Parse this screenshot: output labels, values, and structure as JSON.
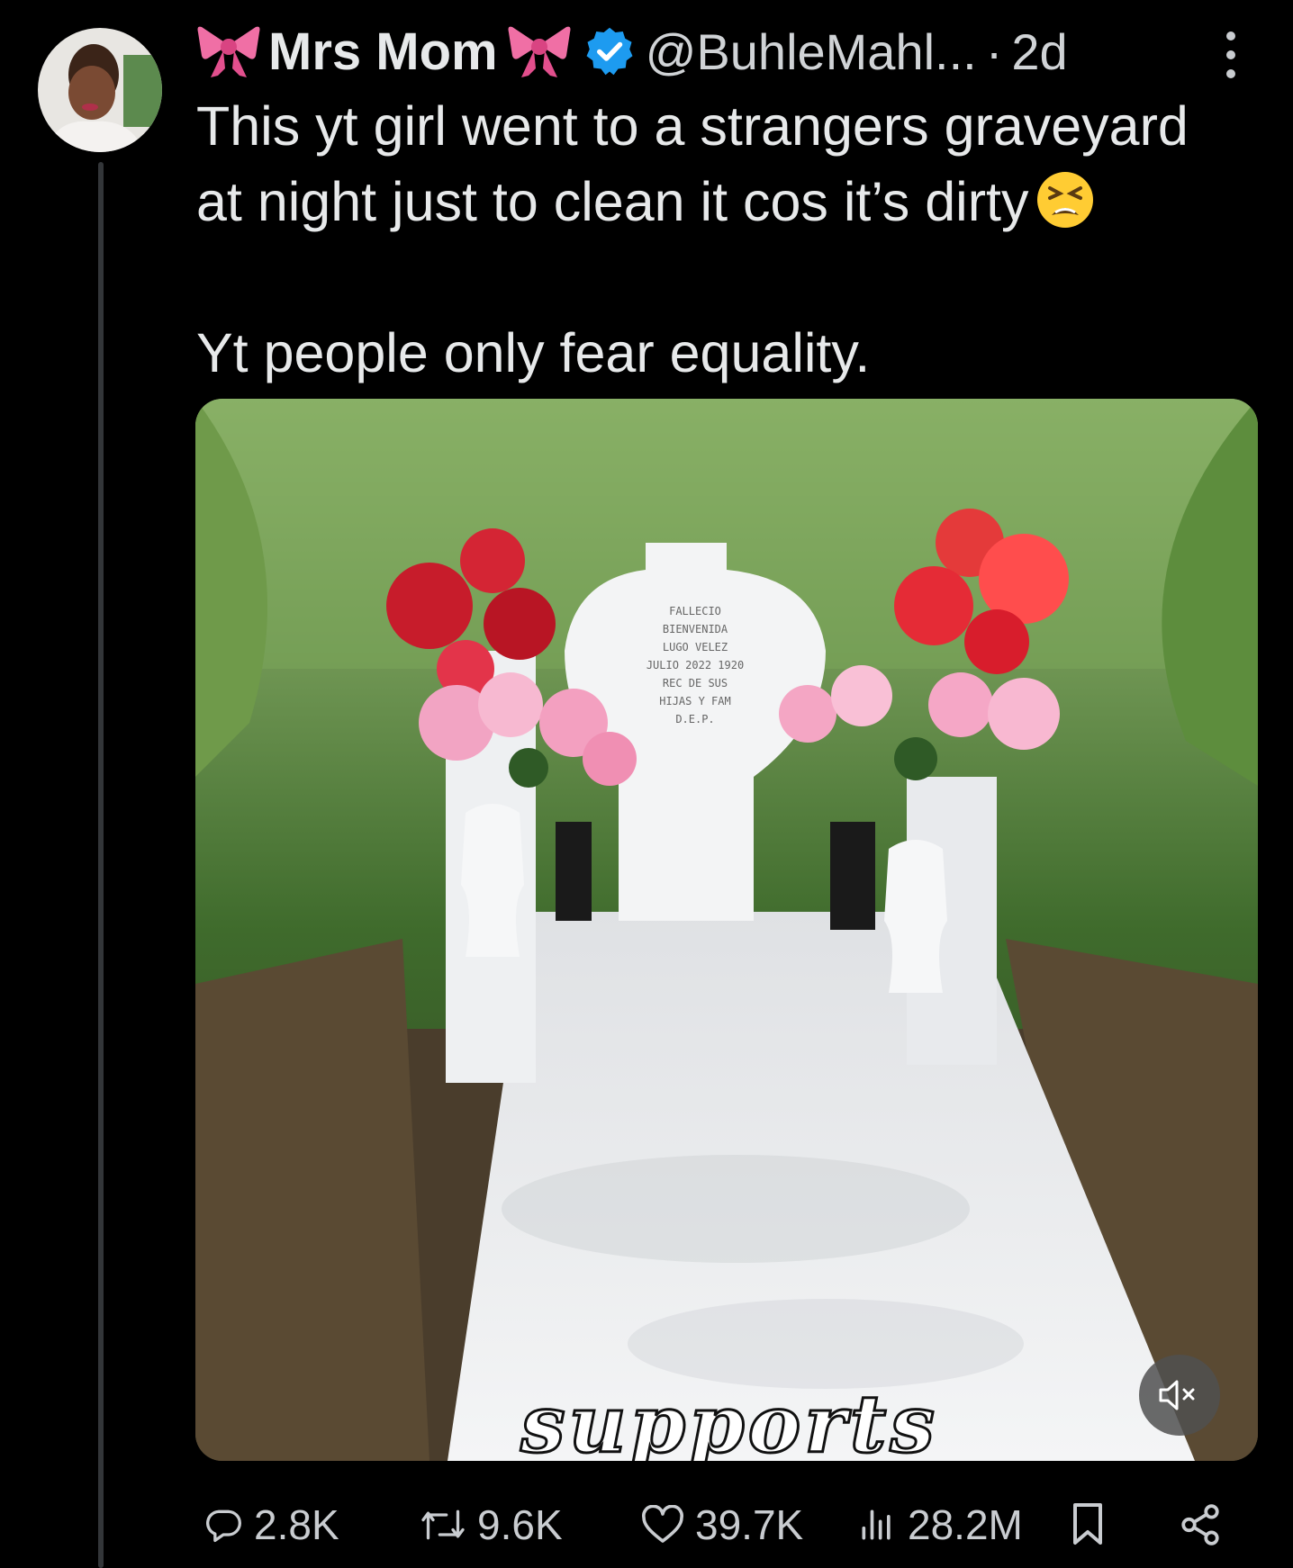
{
  "tweet": {
    "author_name": "Mrs Mom",
    "handle": "@BuhleMahl...",
    "separator": "·",
    "time": "2d",
    "text_line1": "This yt girl went to a strangers graveyard",
    "text_line2": "at night just to clean it cos it’s dirty",
    "text_line3": "Yt people only fear equality.",
    "emoji_icon": "tired-face-emoji"
  },
  "media": {
    "caption": "supports",
    "headstone_inscription": [
      "FALLECIO",
      "BIENVENIDA",
      "LUGO VELEZ",
      "JULIO 2022 1920",
      "REC DE SUS",
      "HIJAS Y FAM",
      "D.E.P."
    ],
    "mute_icon": "volume-muted-icon"
  },
  "actions": {
    "replies": "2.8K",
    "reposts": "9.6K",
    "likes": "39.7K",
    "views": "28.2M"
  },
  "colors": {
    "background": "#000000",
    "text": "#e7e9ea",
    "secondary": "#c9ccd0",
    "verified": "#1d9bf0",
    "bow": "#f06fa5"
  }
}
